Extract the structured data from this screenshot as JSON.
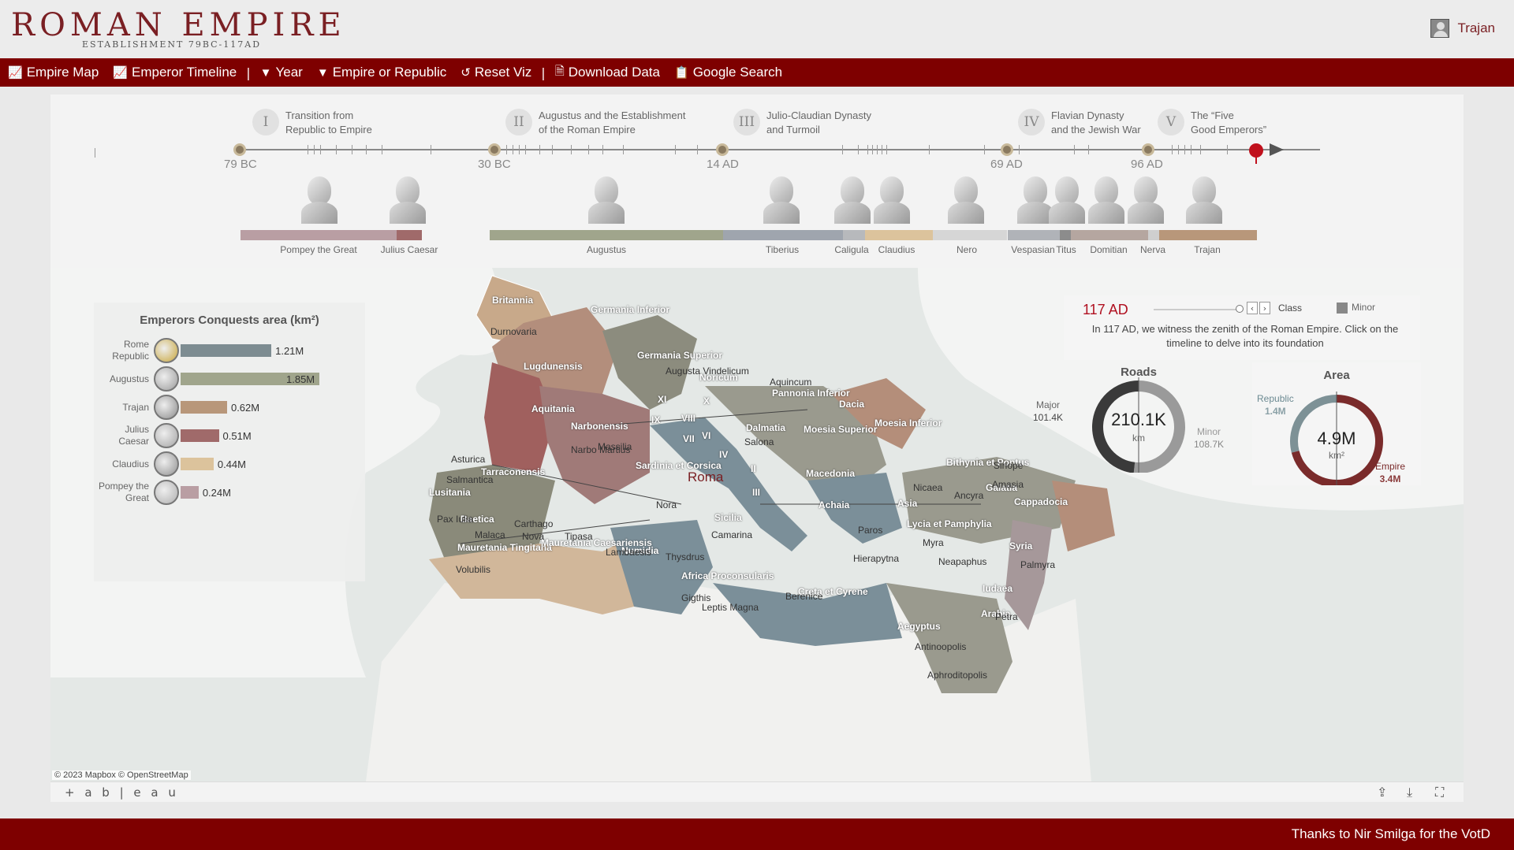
{
  "header": {
    "title": "ROMAN EMPIRE",
    "subtitle": "ESTABLISHMENT 79BC-117AD",
    "user_name": "Trajan"
  },
  "toolbar": {
    "items": [
      {
        "label": "Empire Map",
        "icon": "chart-icon"
      },
      {
        "label": "Emperor Timeline",
        "icon": "chart-icon"
      },
      {
        "label": "Year",
        "icon": "filter-icon"
      },
      {
        "label": "Empire or Republic",
        "icon": "filter-icon"
      },
      {
        "label": "Reset Viz",
        "icon": "reset-icon"
      },
      {
        "label": "Download Data",
        "icon": "file-icon"
      },
      {
        "label": "Google Search",
        "icon": "clipboard-icon"
      }
    ]
  },
  "timeline": {
    "eras": [
      {
        "numeral": "I",
        "title_line1": "Transition from",
        "title_line2": "Republic to Empire"
      },
      {
        "numeral": "II",
        "title_line1": "Augustus and the Establishment",
        "title_line2": "of the Roman Empire"
      },
      {
        "numeral": "III",
        "title_line1": "Julio-Claudian Dynasty",
        "title_line2": "and Turmoil"
      },
      {
        "numeral": "IV",
        "title_line1": "Flavian Dynasty",
        "title_line2": "and the Jewish War"
      },
      {
        "numeral": "V",
        "title_line1": "The “Five",
        "title_line2": "Good Emperors”"
      }
    ],
    "milestones": [
      "79 BC",
      "30 BC",
      "14 AD",
      "69 AD",
      "96 AD"
    ],
    "emperors": [
      {
        "name": "Pompey the Great",
        "color": "#b99ea3"
      },
      {
        "name": "Julius Caesar",
        "color": "#a06a6a"
      },
      {
        "name": "Augustus",
        "color": "#a0a58c"
      },
      {
        "name": "Tiberius",
        "color": "#9fa5ae"
      },
      {
        "name": "Caligula",
        "color": "#b7b9bc"
      },
      {
        "name": "Claudius",
        "color": "#dcc39c"
      },
      {
        "name": "Nero",
        "color": "#d6d6d6"
      },
      {
        "name": "Vespasian",
        "color": "#b0b3b8"
      },
      {
        "name": "Titus",
        "color": "#8c8c8c"
      },
      {
        "name": "Domitian",
        "color": "#b5a6a0"
      },
      {
        "name": "Nerva",
        "color": "#cfcfcf"
      },
      {
        "name": "Trajan",
        "color": "#b8977a"
      }
    ]
  },
  "conquests": {
    "title": "Emperors Conquests area (km²)",
    "rows": [
      {
        "label_line1": "Rome",
        "label_line2": "Republic",
        "value": 1.21,
        "value_label": "1.21M",
        "color": "#7d8c91",
        "coin_color": "#c9a63a"
      },
      {
        "label_line1": "Augustus",
        "label_line2": "",
        "value": 1.85,
        "value_label": "1.85M",
        "color": "#a0a58c",
        "coin_color": "#9c9c9c"
      },
      {
        "label_line1": "Trajan",
        "label_line2": "",
        "value": 0.62,
        "value_label": "0.62M",
        "color": "#b8977a",
        "coin_color": "#8d8d8d"
      },
      {
        "label_line1": "Julius",
        "label_line2": "Caesar",
        "value": 0.51,
        "value_label": "0.51M",
        "color": "#a06a6a",
        "coin_color": "#a5a5a5"
      },
      {
        "label_line1": "Claudius",
        "label_line2": "",
        "value": 0.44,
        "value_label": "0.44M",
        "color": "#dcc39c",
        "coin_color": "#929292"
      },
      {
        "label_line1": "Pompey the",
        "label_line2": "Great",
        "value": 0.24,
        "value_label": "0.24M",
        "color": "#b99ea3",
        "coin_color": "#b0b0b0"
      }
    ]
  },
  "info": {
    "year": "117 AD",
    "class_label": "Class",
    "legend_minor": "Minor",
    "text": "In 117 AD, we witness the zenith of the Roman Empire. Click on the timeline to delve into its foundation"
  },
  "roads": {
    "title": "Roads",
    "center_value": "210.1K",
    "center_unit": "km",
    "major_label": "Major",
    "major_value": "101.4K",
    "minor_label": "Minor",
    "minor_value": "108.7K",
    "major_share": 0.483,
    "major_color": "#3a3a3a",
    "minor_color": "#9a9a9a"
  },
  "area": {
    "title": "Area",
    "center_value": "4.9M",
    "center_unit": "km²",
    "republic_label": "Republic",
    "republic_value": "1.4M",
    "empire_label": "Empire",
    "empire_value": "3.4M",
    "republic_share": 0.29,
    "republic_color": "#7d9196",
    "empire_color": "#7a2b2b"
  },
  "map": {
    "attribution": "© 2023 Mapbox © OpenStreetMap",
    "capital": "Roma",
    "provinces": [
      "Britannia",
      "Germania Inferior",
      "Germania Superior",
      "Lugdunensis",
      "Aquitania",
      "Narbonensis",
      "Noricum",
      "Pannonia Inferior",
      "Dacia",
      "Moesia Inferior",
      "Moesia Superior",
      "Dalmatia",
      "Tarraconensis",
      "Lusitania",
      "Baetica",
      "Mauretania Tingitana",
      "Mauretania Caesariensis",
      "Numidia",
      "Sardinia et Corsica",
      "Sicilia",
      "Macedonia",
      "Achaia",
      "Asia",
      "Bithynia et Pontus",
      "Galatia",
      "Cappadocia",
      "Lycia et Pamphylia",
      "Syria",
      "Iudaea",
      "Arabia",
      "Aegyptus",
      "Creta et Cyrene",
      "Africa Proconsularis"
    ],
    "regions": [
      "X",
      "XI",
      "IX",
      "VIII",
      "VII",
      "VI",
      "IV",
      "II",
      "III"
    ],
    "cities": [
      "Durnovaria",
      "Aquincum",
      "Massilia",
      "Narbo Martius",
      "Salona",
      "Asturica",
      "Salmantica",
      "Pax Iulia",
      "Malaca",
      "Carthago",
      "Nova",
      "Tipasa",
      "Lambaesis",
      "Thysdrus",
      "Volubilis",
      "Nora",
      "Camarina",
      "Gigthis",
      "Leptis Magna",
      "Berenice",
      "Paros",
      "Hierapytna",
      "Myra",
      "Neapaphus",
      "Palmyra",
      "Petra",
      "Antinoopolis",
      "Aphroditopolis",
      "Nicaea",
      "Ancyra",
      "Amasia",
      "Sinope",
      "Augusta Vindelicum"
    ]
  },
  "tableau": {
    "logo": "+ a b | e a u"
  },
  "footer": {
    "credit": "Thanks to Nir Smilga for the VotD"
  }
}
